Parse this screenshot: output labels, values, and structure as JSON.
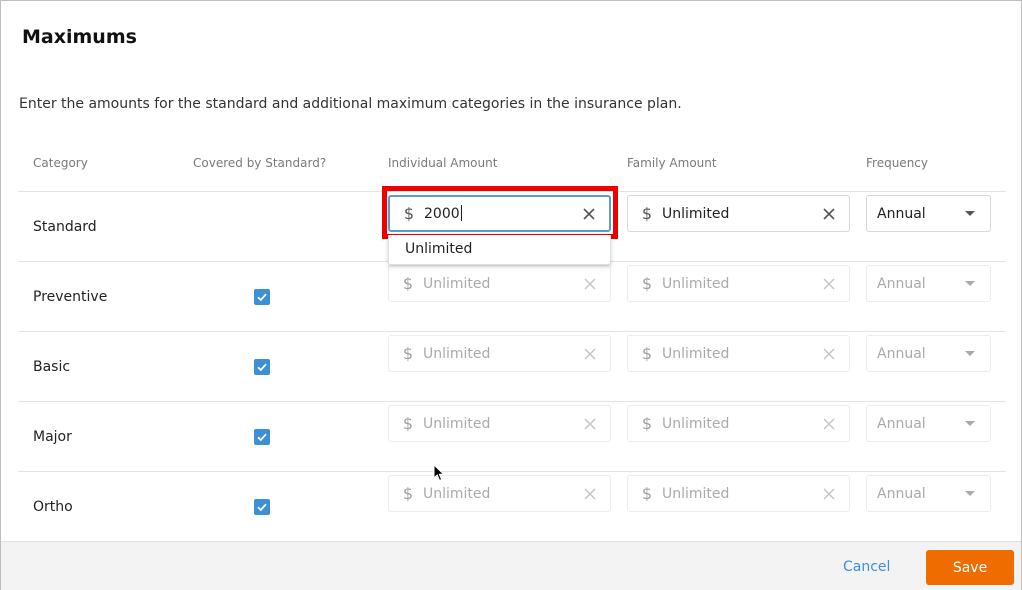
{
  "dialog": {
    "title": "Maximums",
    "description": "Enter the amounts for the standard and additional maximum categories in the insurance plan."
  },
  "columns": {
    "category": "Category",
    "covered": "Covered by Standard?",
    "individual": "Individual Amount",
    "family": "Family Amount",
    "frequency": "Frequency"
  },
  "currency_symbol": "$",
  "rows": [
    {
      "category": "Standard",
      "covered": null,
      "individual": "2000",
      "family": "Unlimited",
      "frequency": "Annual",
      "enabled": true
    },
    {
      "category": "Preventive",
      "covered": true,
      "individual": "Unlimited",
      "family": "Unlimited",
      "frequency": "Annual",
      "enabled": false
    },
    {
      "category": "Basic",
      "covered": true,
      "individual": "Unlimited",
      "family": "Unlimited",
      "frequency": "Annual",
      "enabled": false
    },
    {
      "category": "Major",
      "covered": true,
      "individual": "Unlimited",
      "family": "Unlimited",
      "frequency": "Annual",
      "enabled": false
    },
    {
      "category": "Ortho",
      "covered": true,
      "individual": "Unlimited",
      "family": "Unlimited",
      "frequency": "Annual",
      "enabled": false
    }
  ],
  "dropdown": {
    "options": [
      "Unlimited"
    ]
  },
  "footer": {
    "cancel_label": "Cancel",
    "save_label": "Save"
  },
  "colors": {
    "accent": "#3d8fd6",
    "save": "#ee6c00",
    "highlight": "#ee0000"
  }
}
